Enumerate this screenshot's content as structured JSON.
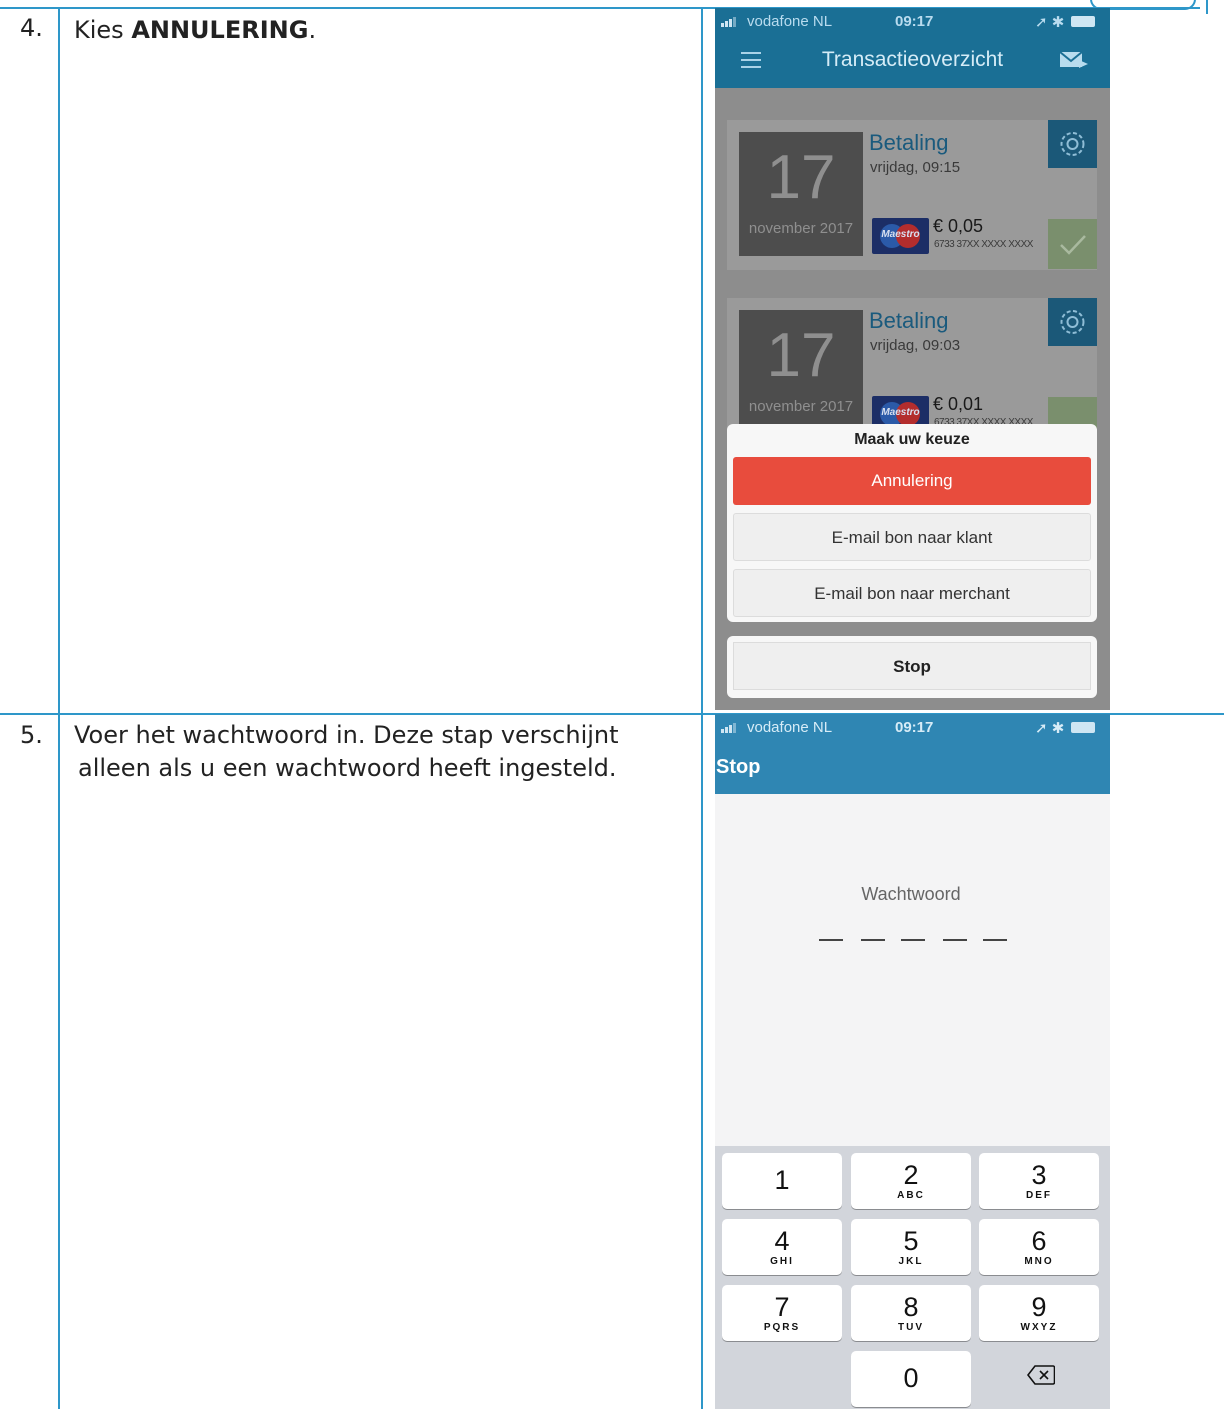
{
  "steps": [
    {
      "number": "4.",
      "text_prefix": "Kies ",
      "text_bold": "ANNULERING",
      "text_suffix": "."
    },
    {
      "number": "5.",
      "line1": "Voer het wachtwoord in. Deze stap verschijnt",
      "line2": "alleen als u een wachtwoord heeft ingesteld."
    }
  ],
  "screen1": {
    "status": {
      "carrier": "vodafone NL",
      "time": "09:17"
    },
    "title": "Transactieoverzicht",
    "transactions": [
      {
        "day": "17",
        "month": "november 2017",
        "type": "Betaling",
        "datetime": "vrijdag, 09:15",
        "card_brand": "Maestro",
        "amount": "€ 0,05",
        "pan": "6733 37XX XXXX XXXX"
      },
      {
        "day": "17",
        "month": "november 2017",
        "type": "Betaling",
        "datetime": "vrijdag, 09:03",
        "card_brand": "Maestro",
        "amount": "€ 0,01",
        "pan": "6733 37XX XXXX XXXX"
      }
    ],
    "action_sheet": {
      "title": "Maak uw keuze",
      "options": [
        "Annulering",
        "E-mail bon naar klant",
        "E-mail bon naar merchant"
      ],
      "cancel": "Stop"
    },
    "colors": {
      "appbar": "#1a6f95",
      "cancel_button": "#e84c3d"
    }
  },
  "screen2": {
    "status": {
      "carrier": "vodafone NL",
      "time": "09:17"
    },
    "back_label": "Stop",
    "password_label": "Wachtwoord",
    "password_digits": 5,
    "keypad": [
      {
        "num": "1",
        "letters": ""
      },
      {
        "num": "2",
        "letters": "ABC"
      },
      {
        "num": "3",
        "letters": "DEF"
      },
      {
        "num": "4",
        "letters": "GHI"
      },
      {
        "num": "5",
        "letters": "JKL"
      },
      {
        "num": "6",
        "letters": "MNO"
      },
      {
        "num": "7",
        "letters": "PQRS"
      },
      {
        "num": "8",
        "letters": "TUV"
      },
      {
        "num": "9",
        "letters": "WXYZ"
      },
      {
        "num": "0",
        "letters": ""
      }
    ],
    "colors": {
      "appbar": "#2f86b3"
    }
  }
}
